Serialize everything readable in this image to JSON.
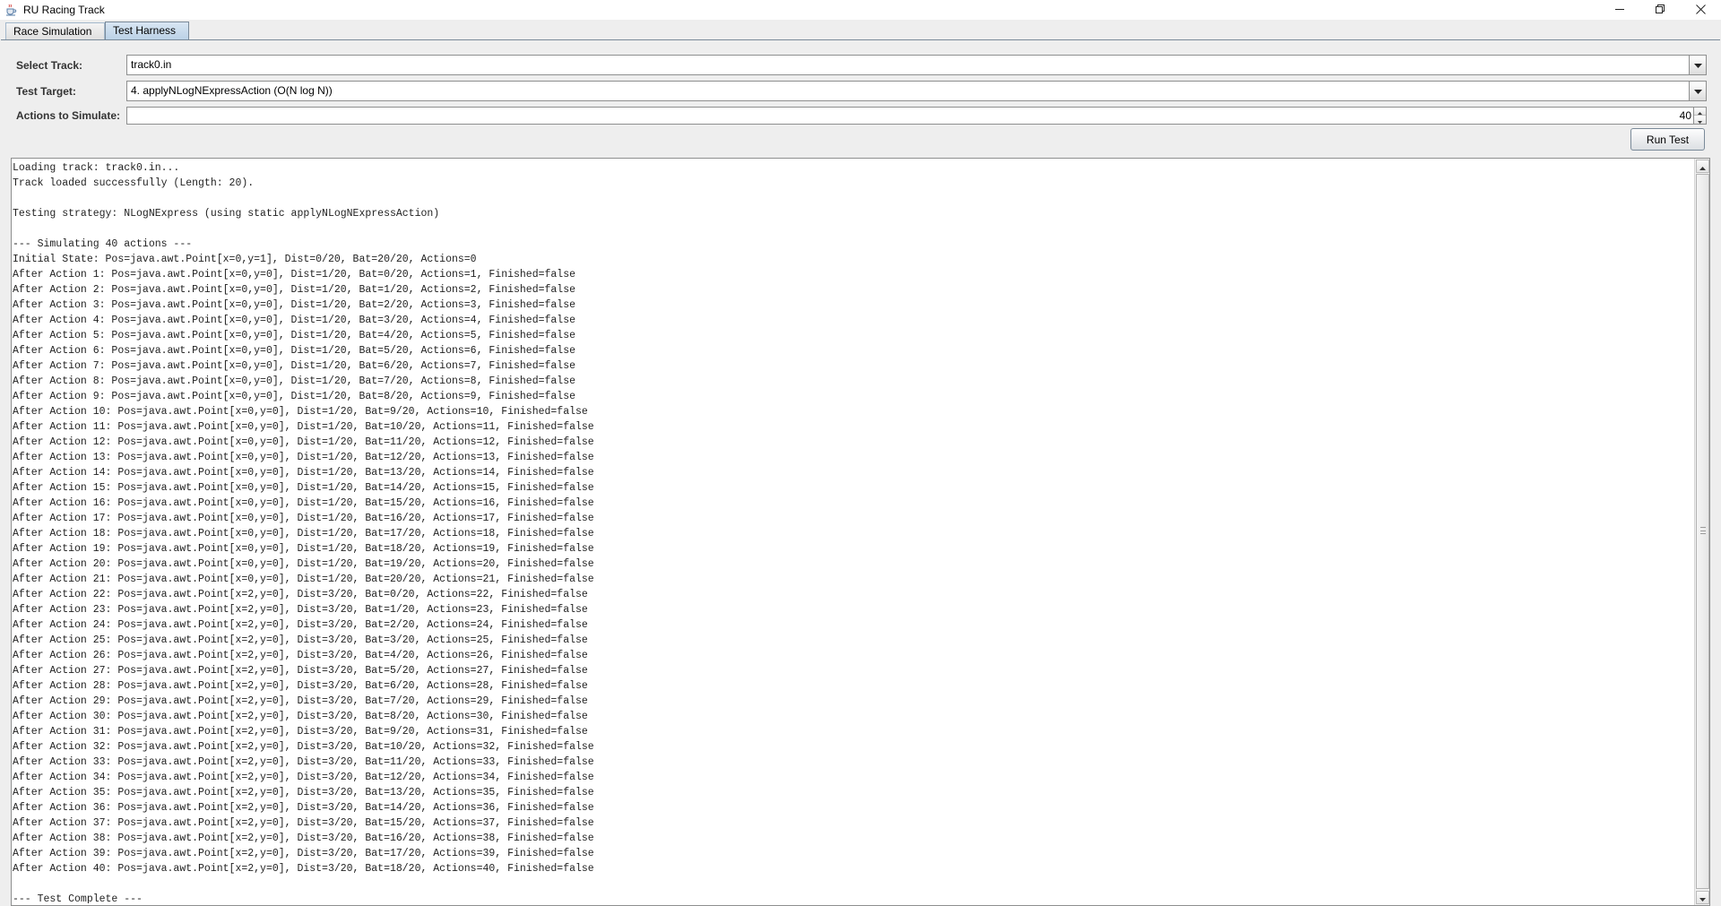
{
  "window": {
    "title": "RU Racing Track"
  },
  "tabs": [
    {
      "label": "Race Simulation",
      "active": false
    },
    {
      "label": "Test Harness",
      "active": true
    }
  ],
  "form": {
    "track_label": "Select Track:",
    "track_value": "track0.in",
    "target_label": "Test Target:",
    "target_value": "4. applyNLogNExpressAction (O(N log N))",
    "actions_label": "Actions to Simulate:",
    "actions_value": "40",
    "run_button_label": "Run Test"
  },
  "output": {
    "lines": [
      "Loading track: track0.in...",
      "Track loaded successfully (Length: 20).",
      "",
      "Testing strategy: NLogNExpress (using static applyNLogNExpressAction)",
      "",
      "--- Simulating 40 actions ---",
      "Initial State: Pos=java.awt.Point[x=0,y=1], Dist=0/20, Bat=20/20, Actions=0",
      "After Action 1: Pos=java.awt.Point[x=0,y=0], Dist=1/20, Bat=0/20, Actions=1, Finished=false",
      "After Action 2: Pos=java.awt.Point[x=0,y=0], Dist=1/20, Bat=1/20, Actions=2, Finished=false",
      "After Action 3: Pos=java.awt.Point[x=0,y=0], Dist=1/20, Bat=2/20, Actions=3, Finished=false",
      "After Action 4: Pos=java.awt.Point[x=0,y=0], Dist=1/20, Bat=3/20, Actions=4, Finished=false",
      "After Action 5: Pos=java.awt.Point[x=0,y=0], Dist=1/20, Bat=4/20, Actions=5, Finished=false",
      "After Action 6: Pos=java.awt.Point[x=0,y=0], Dist=1/20, Bat=5/20, Actions=6, Finished=false",
      "After Action 7: Pos=java.awt.Point[x=0,y=0], Dist=1/20, Bat=6/20, Actions=7, Finished=false",
      "After Action 8: Pos=java.awt.Point[x=0,y=0], Dist=1/20, Bat=7/20, Actions=8, Finished=false",
      "After Action 9: Pos=java.awt.Point[x=0,y=0], Dist=1/20, Bat=8/20, Actions=9, Finished=false",
      "After Action 10: Pos=java.awt.Point[x=0,y=0], Dist=1/20, Bat=9/20, Actions=10, Finished=false",
      "After Action 11: Pos=java.awt.Point[x=0,y=0], Dist=1/20, Bat=10/20, Actions=11, Finished=false",
      "After Action 12: Pos=java.awt.Point[x=0,y=0], Dist=1/20, Bat=11/20, Actions=12, Finished=false",
      "After Action 13: Pos=java.awt.Point[x=0,y=0], Dist=1/20, Bat=12/20, Actions=13, Finished=false",
      "After Action 14: Pos=java.awt.Point[x=0,y=0], Dist=1/20, Bat=13/20, Actions=14, Finished=false",
      "After Action 15: Pos=java.awt.Point[x=0,y=0], Dist=1/20, Bat=14/20, Actions=15, Finished=false",
      "After Action 16: Pos=java.awt.Point[x=0,y=0], Dist=1/20, Bat=15/20, Actions=16, Finished=false",
      "After Action 17: Pos=java.awt.Point[x=0,y=0], Dist=1/20, Bat=16/20, Actions=17, Finished=false",
      "After Action 18: Pos=java.awt.Point[x=0,y=0], Dist=1/20, Bat=17/20, Actions=18, Finished=false",
      "After Action 19: Pos=java.awt.Point[x=0,y=0], Dist=1/20, Bat=18/20, Actions=19, Finished=false",
      "After Action 20: Pos=java.awt.Point[x=0,y=0], Dist=1/20, Bat=19/20, Actions=20, Finished=false",
      "After Action 21: Pos=java.awt.Point[x=0,y=0], Dist=1/20, Bat=20/20, Actions=21, Finished=false",
      "After Action 22: Pos=java.awt.Point[x=2,y=0], Dist=3/20, Bat=0/20, Actions=22, Finished=false",
      "After Action 23: Pos=java.awt.Point[x=2,y=0], Dist=3/20, Bat=1/20, Actions=23, Finished=false",
      "After Action 24: Pos=java.awt.Point[x=2,y=0], Dist=3/20, Bat=2/20, Actions=24, Finished=false",
      "After Action 25: Pos=java.awt.Point[x=2,y=0], Dist=3/20, Bat=3/20, Actions=25, Finished=false",
      "After Action 26: Pos=java.awt.Point[x=2,y=0], Dist=3/20, Bat=4/20, Actions=26, Finished=false",
      "After Action 27: Pos=java.awt.Point[x=2,y=0], Dist=3/20, Bat=5/20, Actions=27, Finished=false",
      "After Action 28: Pos=java.awt.Point[x=2,y=0], Dist=3/20, Bat=6/20, Actions=28, Finished=false",
      "After Action 29: Pos=java.awt.Point[x=2,y=0], Dist=3/20, Bat=7/20, Actions=29, Finished=false",
      "After Action 30: Pos=java.awt.Point[x=2,y=0], Dist=3/20, Bat=8/20, Actions=30, Finished=false",
      "After Action 31: Pos=java.awt.Point[x=2,y=0], Dist=3/20, Bat=9/20, Actions=31, Finished=false",
      "After Action 32: Pos=java.awt.Point[x=2,y=0], Dist=3/20, Bat=10/20, Actions=32, Finished=false",
      "After Action 33: Pos=java.awt.Point[x=2,y=0], Dist=3/20, Bat=11/20, Actions=33, Finished=false",
      "After Action 34: Pos=java.awt.Point[x=2,y=0], Dist=3/20, Bat=12/20, Actions=34, Finished=false",
      "After Action 35: Pos=java.awt.Point[x=2,y=0], Dist=3/20, Bat=13/20, Actions=35, Finished=false",
      "After Action 36: Pos=java.awt.Point[x=2,y=0], Dist=3/20, Bat=14/20, Actions=36, Finished=false",
      "After Action 37: Pos=java.awt.Point[x=2,y=0], Dist=3/20, Bat=15/20, Actions=37, Finished=false",
      "After Action 38: Pos=java.awt.Point[x=2,y=0], Dist=3/20, Bat=16/20, Actions=38, Finished=false",
      "After Action 39: Pos=java.awt.Point[x=2,y=0], Dist=3/20, Bat=17/20, Actions=39, Finished=false",
      "After Action 40: Pos=java.awt.Point[x=2,y=0], Dist=3/20, Bat=18/20, Actions=40, Finished=false",
      "",
      "--- Test Complete ---"
    ]
  },
  "icons": {
    "app": "java-cup-icon",
    "minimize": "minimize-icon",
    "maximize": "restore-icon",
    "close": "close-icon",
    "dropdown": "chevron-down-icon"
  },
  "colors": {
    "active_tab": "#b8cfe5",
    "panel_background": "#eeeeee"
  }
}
